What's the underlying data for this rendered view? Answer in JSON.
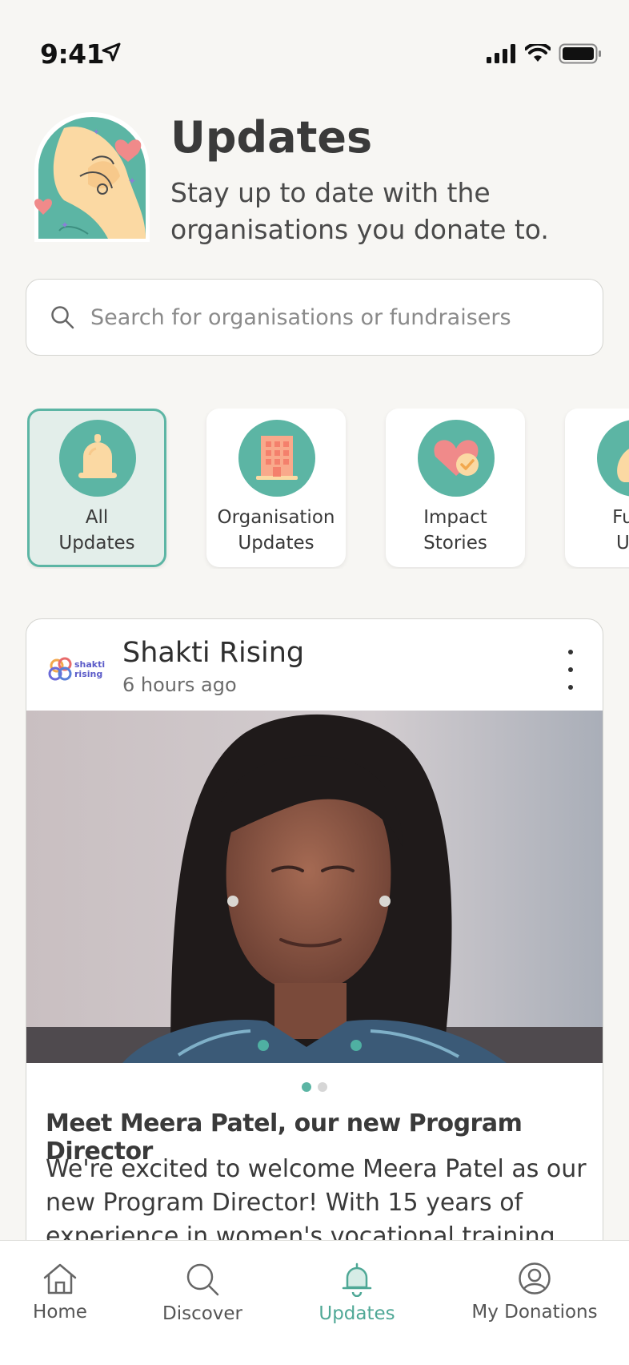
{
  "status_bar": {
    "time": "9:41"
  },
  "header": {
    "title": "Updates",
    "subtitle": "Stay up to date with the organisations you donate to."
  },
  "search": {
    "placeholder": "Search for organisations or fundraisers",
    "value": ""
  },
  "categories": [
    {
      "label_line1": "All",
      "label_line2": "Updates",
      "icon": "bell-icon",
      "active": true
    },
    {
      "label_line1": "Organisation",
      "label_line2": "Updates",
      "icon": "building-icon",
      "active": false
    },
    {
      "label_line1": "Impact",
      "label_line2": "Stories",
      "icon": "heart-check-icon",
      "active": false
    },
    {
      "label_line1": "Fund",
      "label_line2": "Upd",
      "icon": "money-bag-icon",
      "active": false
    }
  ],
  "post": {
    "org_name": "Shakti Rising",
    "org_logo_text": "shakti rising",
    "time_ago": "6 hours ago",
    "image_count": 2,
    "current_image": 1,
    "title": "Meet Meera Patel, our new Program Director",
    "body": "We're excited to welcome Meera Patel as our new Program Director! With 15 years of experience in women's vocational training"
  },
  "nav": {
    "home": "Home",
    "discover": "Discover",
    "updates": "Updates",
    "donations": "My Donations"
  },
  "colors": {
    "accent": "#5cb5a4",
    "background": "#f7f6f3",
    "active_chip_bg": "#e3eeea"
  }
}
